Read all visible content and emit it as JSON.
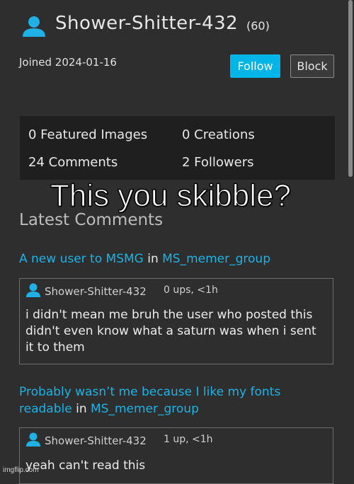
{
  "profile": {
    "username": "Shower-Shitter-432",
    "points": "(60)",
    "joined": "Joined 2024-01-16",
    "follow_label": "Follow",
    "block_label": "Block",
    "icon": "user-icon",
    "accent": "#00b6e8"
  },
  "stats": {
    "featured": "0 Featured Images",
    "creations": "0 Creations",
    "comments": "24 Comments",
    "followers": "2 Followers"
  },
  "overlay_caption": "This you skibble?",
  "latest": {
    "title": "Latest Comments",
    "threads": [
      {
        "post_title": "A new user to MSMG",
        "in_word": "in",
        "stream": "MS_memer_group",
        "comment_user": "Shower-Shitter-432",
        "comment_meta": "0 ups, <1h",
        "comment_text": "i didn't mean me bruh the user who posted this didn't even know what a saturn was when i sent it to them"
      },
      {
        "post_title": "Probably wasn’t me because I like my fonts readable",
        "in_word": "in",
        "stream": "MS_memer_group",
        "comment_user": "Shower-Shitter-432",
        "comment_meta": "1 up, <1h",
        "comment_text": "yeah can't read this"
      }
    ]
  },
  "watermark": "imgflip.com"
}
